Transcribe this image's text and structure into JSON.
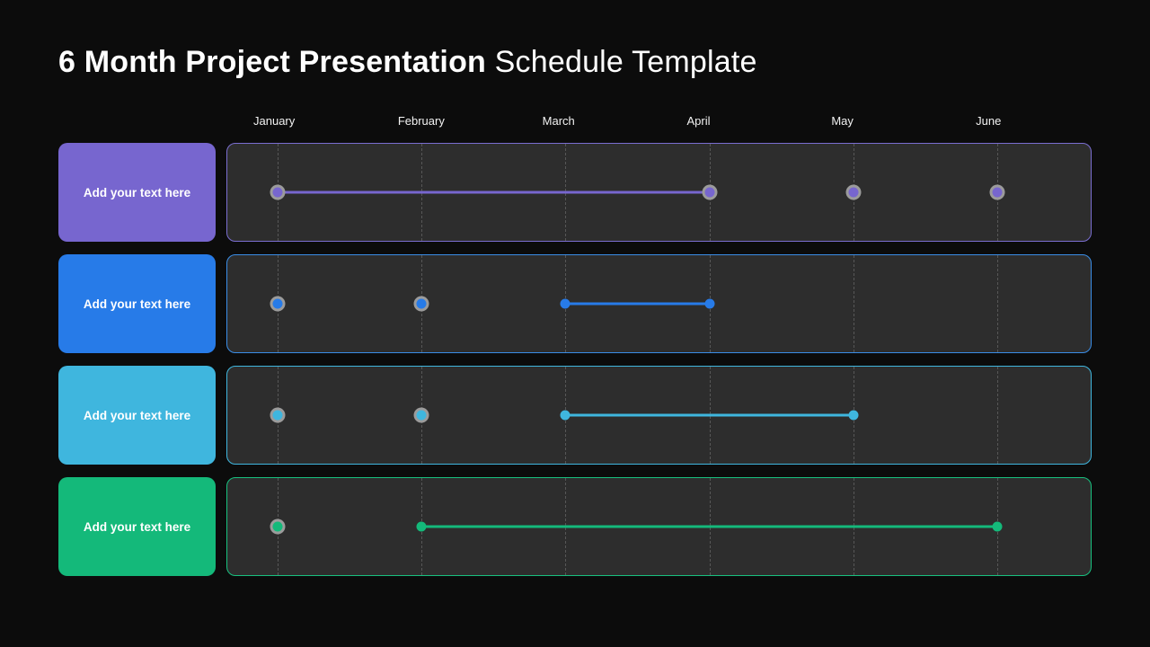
{
  "title_bold": "6 Month Project Presentation",
  "title_light": " Schedule Template",
  "months": [
    "January",
    "February",
    "March",
    "April",
    "May",
    "June"
  ],
  "rows": [
    {
      "label": "Add your text here",
      "color": "#7766cf",
      "border": "#7a6ed0",
      "segments": [
        {
          "from": 0,
          "to": 3
        }
      ],
      "large_dots": [
        0,
        3,
        4,
        5
      ],
      "small_dots": []
    },
    {
      "label": "Add your text here",
      "color": "#277be8",
      "border": "#3a8de6",
      "segments": [
        {
          "from": 2,
          "to": 3
        }
      ],
      "large_dots": [
        0,
        1
      ],
      "small_dots": [
        2,
        3
      ]
    },
    {
      "label": "Add your text here",
      "color": "#3fb6de",
      "border": "#3fb6de",
      "segments": [
        {
          "from": 2,
          "to": 4
        }
      ],
      "large_dots": [
        0,
        1
      ],
      "small_dots": [
        2,
        4
      ]
    },
    {
      "label": "Add your text here",
      "color": "#14b97a",
      "border": "#18c07f",
      "segments": [
        {
          "from": 1,
          "to": 5
        }
      ],
      "large_dots": [
        0
      ],
      "small_dots": [
        1,
        5
      ]
    }
  ]
}
